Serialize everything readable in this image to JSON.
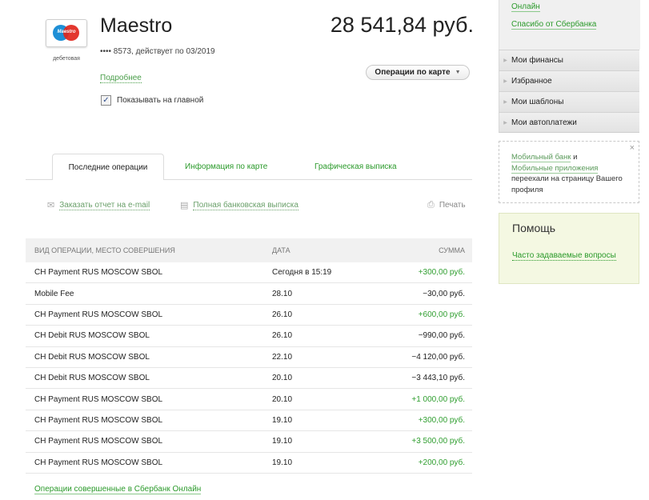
{
  "card": {
    "brand": "Maestro",
    "kind": "дебетовая",
    "title": "Maestro",
    "number": "•••• 8573, действует по 03/2019",
    "balance": "28 541,84 руб.",
    "details_link": "Подробнее",
    "ops_button": "Операции по карте",
    "show_on_main": "Показывать на главной",
    "show_on_main_checked": true
  },
  "tabs": {
    "active": "Последние операции",
    "info": "Информация по карте",
    "graph": "Графическая выписка"
  },
  "actions": {
    "email_report": "Заказать отчет на e-mail",
    "full_statement": "Полная банковская выписка",
    "print": "Печать"
  },
  "table": {
    "headers": [
      "Вид операции, место совершения",
      "Дата",
      "Сумма"
    ],
    "rows": [
      {
        "name": "CH Payment RUS MOSCOW SBOL",
        "date": "Сегодня в 15:19",
        "sum": "+300,00 руб.",
        "positive": true
      },
      {
        "name": "Mobile Fee",
        "date": "28.10",
        "sum": "−30,00 руб.",
        "positive": false
      },
      {
        "name": "CH Payment RUS MOSCOW SBOL",
        "date": "26.10",
        "sum": "+600,00 руб.",
        "positive": true
      },
      {
        "name": "CH Debit RUS MOSCOW SBOL",
        "date": "26.10",
        "sum": "−990,00 руб.",
        "positive": false
      },
      {
        "name": "CH Debit RUS MOSCOW SBOL",
        "date": "22.10",
        "sum": "−4 120,00 руб.",
        "positive": false
      },
      {
        "name": "CH Debit RUS MOSCOW SBOL",
        "date": "20.10",
        "sum": "−3 443,10 руб.",
        "positive": false
      },
      {
        "name": "CH Payment RUS MOSCOW SBOL",
        "date": "20.10",
        "sum": "+1 000,00 руб.",
        "positive": true
      },
      {
        "name": "CH Payment RUS MOSCOW SBOL",
        "date": "19.10",
        "sum": "+300,00 руб.",
        "positive": true
      },
      {
        "name": "CH Payment RUS MOSCOW SBOL",
        "date": "19.10",
        "sum": "+3 500,00 руб.",
        "positive": true
      },
      {
        "name": "CH Payment RUS MOSCOW SBOL",
        "date": "19.10",
        "sum": "+200,00 руб.",
        "positive": true
      }
    ],
    "footer_link": "Операции совершенные в Сбербанк Онлайн"
  },
  "sidebar": {
    "top_link_1": "Онлайн",
    "top_link_2": "Спасибо от Сбербанка",
    "menu": [
      "Мои финансы",
      "Избранное",
      "Мои шаблоны",
      "Мои автоплатежи"
    ],
    "notice": {
      "link_1": "Мобильный банк",
      "conj": "и",
      "link_2": "Мобильные приложения",
      "text": "переехали на страницу Вашего профиля",
      "close": "×"
    },
    "help": {
      "title": "Помощь",
      "link": "Часто задаваемые вопросы"
    }
  },
  "icons": {
    "email": "envelope-icon",
    "statement": "document-icon",
    "print": "printer-icon"
  },
  "colors": {
    "accent_green": "#2b9a2b",
    "help_bg": "#f4f8e2"
  }
}
